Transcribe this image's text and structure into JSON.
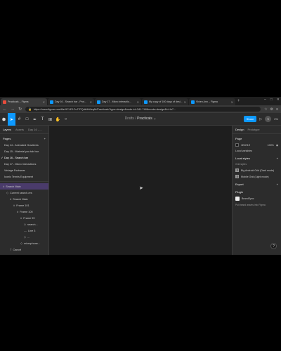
{
  "browser": {
    "tabs": [
      {
        "title": "Practicals – Figma",
        "active": true,
        "color": "#e74c3c"
      },
      {
        "title": "Day 16 - Search bar - Prot...",
        "active": false,
        "color": "#0d99ff"
      },
      {
        "title": "Day 17 - Micro interactio...",
        "active": false,
        "color": "#0d99ff"
      },
      {
        "title": "My copy of 100 days of desi...",
        "active": false,
        "color": "#0d99ff"
      },
      {
        "title": "Vivien Ann – Figma",
        "active": false,
        "color": "#0d99ff"
      }
    ],
    "url": "https://www.figma.com/file/9CLE1CvJ7PQdb/frWeqM/Practicals?type=design&node-id=341-748&mode=design&t=Hu7..."
  },
  "toolbar": {
    "drafts_label": "Drafts",
    "separator": "/",
    "file_name": "Practicals",
    "share_label": "Share",
    "avatar_initial": "V",
    "zoom": "2%"
  },
  "left_panel": {
    "tabs": [
      "Layers",
      "Assets",
      "Day 16 - ..."
    ],
    "pages_heading": "Pages",
    "pages": [
      {
        "label": "Day 14 - Animated Gradients",
        "selected": false
      },
      {
        "label": "Day 15 - Material you tab bar",
        "selected": false
      },
      {
        "label": "Day 16 - Search bar",
        "selected": true
      },
      {
        "label": "Day 17 - Micro Interactions",
        "selected": false
      },
      {
        "label": "Vintage Footwear",
        "selected": false
      },
      {
        "label": "Iconic Tennis Equipment",
        "selected": false
      }
    ],
    "layers": [
      {
        "label": "Search Main",
        "indent": 0,
        "icon": "#",
        "highlight": true
      },
      {
        "label": "Current search-res",
        "indent": 1,
        "icon": "◇",
        "highlight": false
      },
      {
        "label": "Search Main",
        "indent": 2,
        "icon": "#",
        "highlight": false
      },
      {
        "label": "Frame 101",
        "indent": 3,
        "icon": "#",
        "highlight": false
      },
      {
        "label": "Frame 100",
        "indent": 4,
        "icon": "#",
        "highlight": false
      },
      {
        "label": "Frame 99",
        "indent": 5,
        "icon": "#",
        "highlight": false
      },
      {
        "label": "search...",
        "indent": 6,
        "icon": "◇",
        "highlight": false
      },
      {
        "label": "Line 3",
        "indent": 6,
        "icon": "—",
        "highlight": false
      },
      {
        "label": "...",
        "indent": 6,
        "icon": "◇",
        "highlight": false
      },
      {
        "label": "microphone...",
        "indent": 5,
        "icon": "◇",
        "highlight": false
      },
      {
        "label": "Cancel",
        "indent": 2,
        "icon": "T",
        "highlight": false
      }
    ]
  },
  "right_panel": {
    "tabs": [
      "Design",
      "Prototype"
    ],
    "page_heading": "Page",
    "page_color": "1E1E1E",
    "page_opacity": "100%",
    "local_variables": "Local variables",
    "local_styles_heading": "Local styles",
    "grid_styles_label": "Grid styles",
    "grid_styles": [
      "Big Android Grid (Dark mode)",
      "Mobile Grid (Light mode)"
    ],
    "export_label": "Export",
    "plugin_heading": "Plugin",
    "plugin_name": "BrandSync",
    "plugin_desc": "Pull brand assets into Figma",
    "help": "?"
  },
  "colors": {
    "accent": "#0d99ff",
    "canvas": "#1e1e1e",
    "panel": "#2c2c2c",
    "layer_highlight": "#4a3b6b"
  }
}
